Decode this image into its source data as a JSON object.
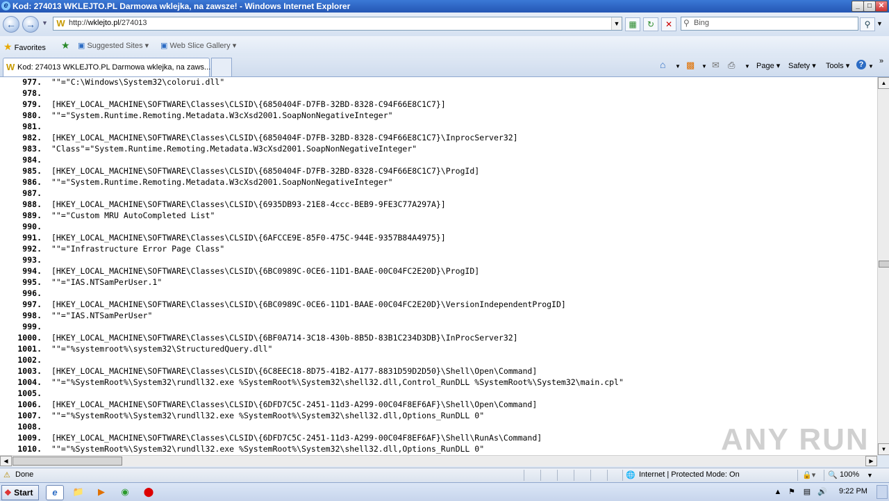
{
  "window": {
    "title": "Kod: 274013 WKLEJTO.PL Darmowa wklejka, na zawsze! - Windows Internet Explorer",
    "min": "_",
    "max": "□",
    "close": "✕"
  },
  "address": {
    "url_prefix": "http://",
    "url_host": "wklejto.pl",
    "url_path": "/274013"
  },
  "search": {
    "placeholder": "Bing"
  },
  "favorites_bar": {
    "favorites_label": "Favorites",
    "suggested_sites": "Suggested Sites",
    "web_slice_gallery": "Web Slice Gallery"
  },
  "tab": {
    "title": "Kod: 274013 WKLEJTO.PL Darmowa wklejka, na zaws..."
  },
  "command_bar": {
    "page": "Page",
    "safety": "Safety",
    "tools": "Tools"
  },
  "lines": [
    {
      "no": "977.",
      "code": "\"\"=\"C:\\Windows\\System32\\colorui.dll\""
    },
    {
      "no": "978.",
      "code": ""
    },
    {
      "no": "979.",
      "code": "[HKEY_LOCAL_MACHINE\\SOFTWARE\\Classes\\CLSID\\{6850404F-D7FB-32BD-8328-C94F66E8C1C7}]"
    },
    {
      "no": "980.",
      "code": "\"\"=\"System.Runtime.Remoting.Metadata.W3cXsd2001.SoapNonNegativeInteger\""
    },
    {
      "no": "981.",
      "code": ""
    },
    {
      "no": "982.",
      "code": "[HKEY_LOCAL_MACHINE\\SOFTWARE\\Classes\\CLSID\\{6850404F-D7FB-32BD-8328-C94F66E8C1C7}\\InprocServer32]"
    },
    {
      "no": "983.",
      "code": "\"Class\"=\"System.Runtime.Remoting.Metadata.W3cXsd2001.SoapNonNegativeInteger\""
    },
    {
      "no": "984.",
      "code": ""
    },
    {
      "no": "985.",
      "code": "[HKEY_LOCAL_MACHINE\\SOFTWARE\\Classes\\CLSID\\{6850404F-D7FB-32BD-8328-C94F66E8C1C7}\\ProgId]"
    },
    {
      "no": "986.",
      "code": "\"\"=\"System.Runtime.Remoting.Metadata.W3cXsd2001.SoapNonNegativeInteger\""
    },
    {
      "no": "987.",
      "code": ""
    },
    {
      "no": "988.",
      "code": "[HKEY_LOCAL_MACHINE\\SOFTWARE\\Classes\\CLSID\\{6935DB93-21E8-4ccc-BEB9-9FE3C77A297A}]"
    },
    {
      "no": "989.",
      "code": "\"\"=\"Custom MRU AutoCompleted List\""
    },
    {
      "no": "990.",
      "code": ""
    },
    {
      "no": "991.",
      "code": "[HKEY_LOCAL_MACHINE\\SOFTWARE\\Classes\\CLSID\\{6AFCCE9E-85F0-475C-944E-9357B84A4975}]"
    },
    {
      "no": "992.",
      "code": "\"\"=\"Infrastructure Error Page Class\""
    },
    {
      "no": "993.",
      "code": ""
    },
    {
      "no": "994.",
      "code": "[HKEY_LOCAL_MACHINE\\SOFTWARE\\Classes\\CLSID\\{6BC0989C-0CE6-11D1-BAAE-00C04FC2E20D}\\ProgID]"
    },
    {
      "no": "995.",
      "code": "\"\"=\"IAS.NTSamPerUser.1\""
    },
    {
      "no": "996.",
      "code": ""
    },
    {
      "no": "997.",
      "code": "[HKEY_LOCAL_MACHINE\\SOFTWARE\\Classes\\CLSID\\{6BC0989C-0CE6-11D1-BAAE-00C04FC2E20D}\\VersionIndependentProgID]"
    },
    {
      "no": "998.",
      "code": "\"\"=\"IAS.NTSamPerUser\""
    },
    {
      "no": "999.",
      "code": ""
    },
    {
      "no": "1000.",
      "code": "[HKEY_LOCAL_MACHINE\\SOFTWARE\\Classes\\CLSID\\{6BF0A714-3C18-430b-8B5D-83B1C234D3DB}\\InProcServer32]"
    },
    {
      "no": "1001.",
      "code": "\"\"=\"%systemroot%\\system32\\StructuredQuery.dll\""
    },
    {
      "no": "1002.",
      "code": ""
    },
    {
      "no": "1003.",
      "code": "[HKEY_LOCAL_MACHINE\\SOFTWARE\\Classes\\CLSID\\{6C8EEC18-8D75-41B2-A177-8831D59D2D50}\\Shell\\Open\\Command]"
    },
    {
      "no": "1004.",
      "code": "\"\"=\"%SystemRoot%\\System32\\rundll32.exe %SystemRoot%\\System32\\shell32.dll,Control_RunDLL %SystemRoot%\\System32\\main.cpl\""
    },
    {
      "no": "1005.",
      "code": ""
    },
    {
      "no": "1006.",
      "code": "[HKEY_LOCAL_MACHINE\\SOFTWARE\\Classes\\CLSID\\{6DFD7C5C-2451-11d3-A299-00C04F8EF6AF}\\Shell\\Open\\Command]"
    },
    {
      "no": "1007.",
      "code": "\"\"=\"%SystemRoot%\\System32\\rundll32.exe %SystemRoot%\\System32\\shell32.dll,Options_RunDLL 0\""
    },
    {
      "no": "1008.",
      "code": ""
    },
    {
      "no": "1009.",
      "code": "[HKEY_LOCAL_MACHINE\\SOFTWARE\\Classes\\CLSID\\{6DFD7C5C-2451-11d3-A299-00C04F8EF6AF}\\Shell\\RunAs\\Command]"
    },
    {
      "no": "1010.",
      "code": "\"\"=\"%SystemRoot%\\System32\\rundll32.exe %SystemRoot%\\System32\\shell32.dll,Options_RunDLL 0\""
    }
  ],
  "status": {
    "text": "Done",
    "zone": "Internet | Protected Mode: On",
    "zoom": "100%"
  },
  "taskbar": {
    "start_label": "Start",
    "clock": "9:22 PM"
  },
  "watermark": "ANY RUN"
}
